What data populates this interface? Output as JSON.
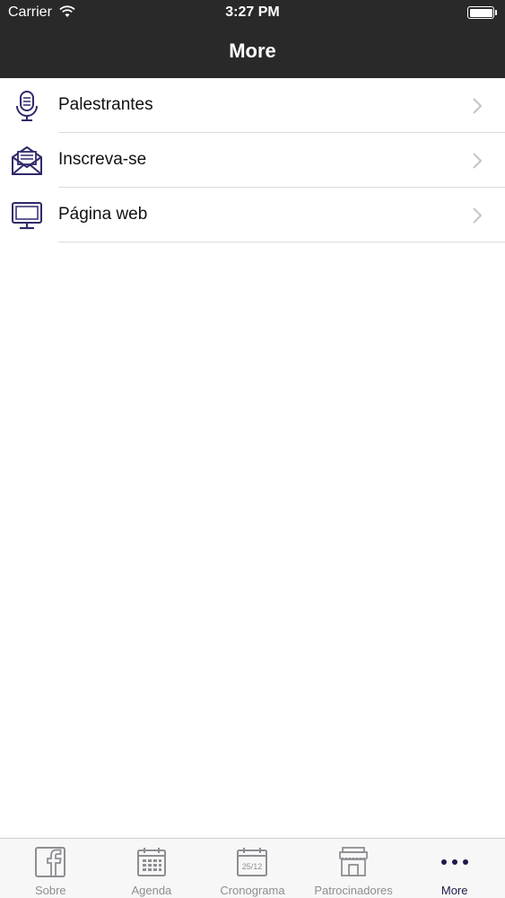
{
  "status_bar": {
    "carrier": "Carrier",
    "time": "3:27 PM"
  },
  "nav": {
    "title": "More"
  },
  "menu": {
    "items": [
      {
        "label": "Palestrantes",
        "icon": "microphone-icon"
      },
      {
        "label": "Inscreva-se",
        "icon": "envelope-icon"
      },
      {
        "label": "Página web",
        "icon": "monitor-icon"
      }
    ]
  },
  "tabbar": {
    "tabs": [
      {
        "label": "Sobre",
        "icon": "facebook-icon",
        "active": false
      },
      {
        "label": "Agenda",
        "icon": "calendar-icon",
        "active": false
      },
      {
        "label": "Cronograma",
        "icon": "date-calendar-icon",
        "date_text": "25/12",
        "active": false
      },
      {
        "label": "Patrocinadores",
        "icon": "storefront-icon",
        "active": false
      },
      {
        "label": "More",
        "icon": "more-dots-icon",
        "active": true
      }
    ]
  },
  "colors": {
    "header_bg": "#2a2929",
    "icon_color": "#2f2a6b",
    "tab_inactive": "#8e8e93",
    "tab_active": "#1d1b4a"
  }
}
